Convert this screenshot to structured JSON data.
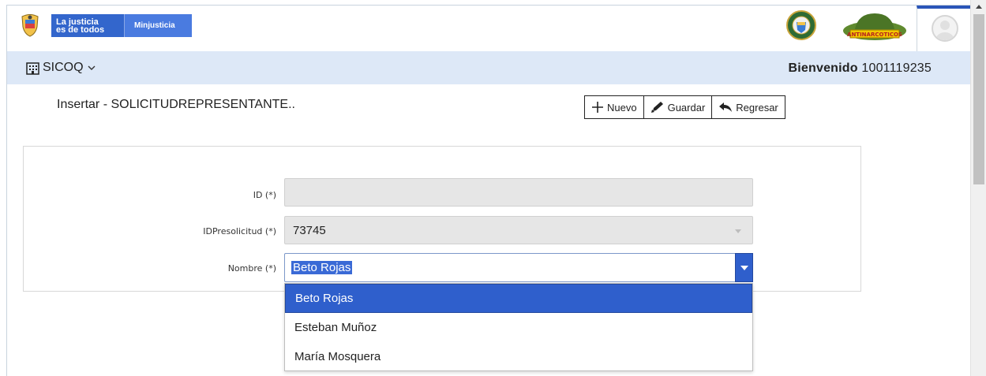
{
  "header": {
    "brand_line1": "La justicia",
    "brand_line2": "es de todos",
    "brand_ministry": "Minjusticia",
    "antinarc_label": "ANTINARCOTICOS"
  },
  "nav": {
    "app_name": "SICOQ",
    "welcome_label": "Bienvenido",
    "user_id": "1001119235"
  },
  "form": {
    "title": "Insertar - SOLICITUDREPRESENTANTE..",
    "toolbar": {
      "new_label": "Nuevo",
      "save_label": "Guardar",
      "back_label": "Regresar"
    },
    "fields": {
      "id_label": "ID (*)",
      "id_value": "",
      "idpre_label": "IDPresolicitud (*)",
      "idpre_value": "73745",
      "nombre_label": "Nombre (*)",
      "nombre_value": "Beto Rojas"
    },
    "options": [
      "Beto Rojas",
      "Esteban Muñoz",
      "María Mosquera"
    ]
  },
  "colors": {
    "brand_blue": "#3366cc",
    "nav_band": "#dde8f7",
    "select_highlight": "#2f5fcc"
  }
}
